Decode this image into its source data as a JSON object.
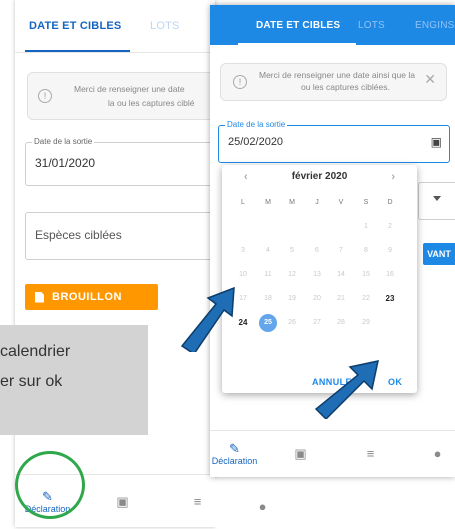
{
  "back_screen": {
    "tabs": [
      {
        "label": "DATE ET CIBLES",
        "active": true
      },
      {
        "label": "LOTS",
        "active": false
      }
    ],
    "info_line1": "Merci de renseigner une date",
    "info_line2": "la ou les captures ciblé",
    "date_field": {
      "label": "Date de la sortie",
      "value": "31/01/2020"
    },
    "species_field": {
      "placeholder": "Espèces ciblées"
    },
    "draft_button": "BROUILLON"
  },
  "front_screen": {
    "tabs": [
      {
        "label": "DATE ET CIBLES",
        "active": true
      },
      {
        "label": "LOTS",
        "active": false
      },
      {
        "label": "ENGINS",
        "active": false
      }
    ],
    "info_line1": "Merci de renseigner une date ainsi que la",
    "info_line2": "ou les captures ciblées.",
    "date_field": {
      "label": "Date de la sortie",
      "value": "25/02/2020"
    },
    "next_button": "VANT",
    "bottom_nav": [
      {
        "icon": "pencil-icon",
        "label": "Déclaration",
        "active": true
      },
      {
        "icon": "calendar-icon",
        "label": "",
        "active": false
      },
      {
        "icon": "list-check-icon",
        "label": "",
        "active": false
      },
      {
        "icon": "person-icon",
        "label": "",
        "active": false
      }
    ]
  },
  "calendar": {
    "month_label": "février 2020",
    "prev_icon": "chevron-left-icon",
    "next_icon": "chevron-right-icon",
    "weekdays": [
      "L",
      "M",
      "M",
      "J",
      "V",
      "S",
      "D"
    ],
    "weeks": [
      [
        "",
        "",
        "",
        "",
        "",
        "1",
        "2"
      ],
      [
        "3",
        "4",
        "5",
        "6",
        "7",
        "8",
        "9"
      ],
      [
        "10",
        "11",
        "12",
        "13",
        "14",
        "15",
        "16"
      ],
      [
        "17",
        "18",
        "19",
        "20",
        "21",
        "22",
        "23"
      ],
      [
        "24",
        "25",
        "26",
        "27",
        "28",
        "29",
        ""
      ]
    ],
    "bold_days": [
      "23",
      "24"
    ],
    "selected_day": "25",
    "cancel_label": "ANNULER",
    "ok_label": "OK"
  },
  "bottom_nav_back": [
    {
      "icon": "pencil-icon",
      "label": "Déclaration",
      "active": true
    },
    {
      "icon": "calendar-icon",
      "label": "",
      "active": false
    },
    {
      "icon": "list-check-icon",
      "label": "",
      "active": false
    },
    {
      "icon": "person-icon",
      "label": "",
      "active": false
    }
  ],
  "instruction": {
    "line1": "calendrier",
    "line2": "er sur ok"
  },
  "colors": {
    "primary": "#1e88e5",
    "draft": "#ff9800",
    "selected_day": "#64a6ec",
    "arrow": "#1f6db5",
    "circle": "#2ea84a",
    "hint_bg": "#d3d3d3"
  }
}
